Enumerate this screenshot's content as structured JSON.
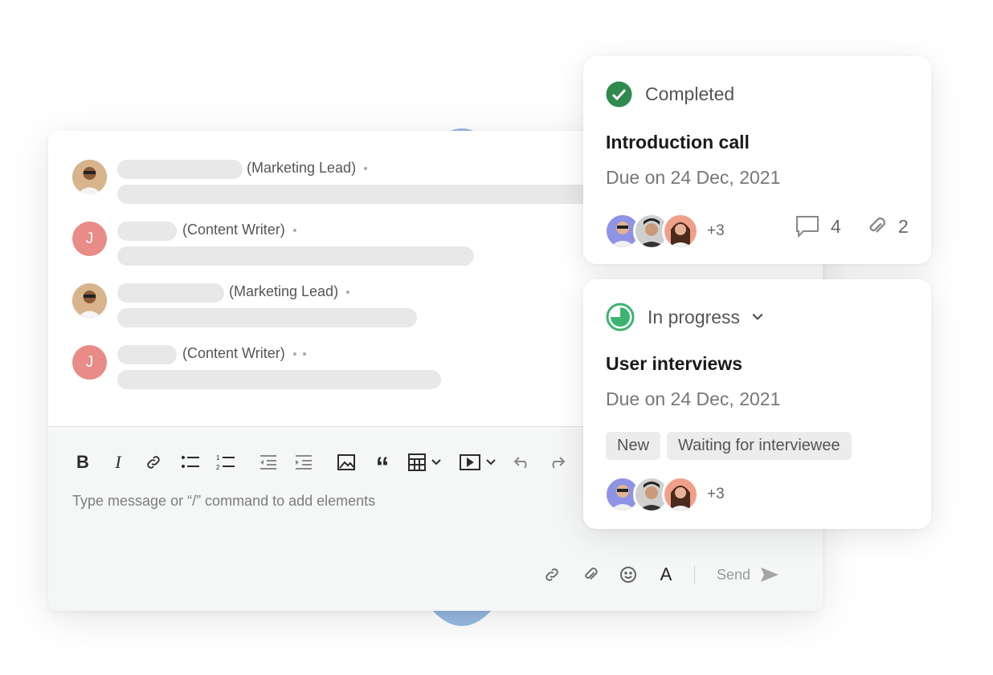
{
  "chat": {
    "messages": [
      {
        "avatar_letter": "",
        "role": "(Marketing Lead)",
        "dots": "•"
      },
      {
        "avatar_letter": "J",
        "role": "(Content Writer)",
        "dots": "•"
      },
      {
        "avatar_letter": "",
        "role": "(Marketing Lead)",
        "dots": "•"
      },
      {
        "avatar_letter": "J",
        "role": "(Content Writer)",
        "dots": "• •"
      }
    ],
    "placeholder": "Type message or “/” command to add elements",
    "toolbar_icons": [
      "bold-icon",
      "italic-icon",
      "link-icon",
      "bullet-list-icon",
      "numbered-list-icon",
      "outdent-icon",
      "indent-icon",
      "image-icon",
      "quote-icon",
      "table-icon",
      "video-icon",
      "undo-icon",
      "redo-icon"
    ],
    "send_label": "Send"
  },
  "tasks": [
    {
      "status": "Completed",
      "title": "Introduction call",
      "due": "Due on 24 Dec, 2021",
      "more_assignees": "+3",
      "comments": "4",
      "attachments": "2"
    },
    {
      "status": "In progress",
      "title": "User interviews",
      "due": "Due on 24 Dec, 2021",
      "tags": [
        "New",
        "Waiting for interviewee"
      ],
      "more_assignees": "+3"
    }
  ],
  "colors": {
    "completed_green": "#2f8a4e",
    "progress_green": "#3cb371",
    "avatar_letter_bg": "#e98b86",
    "blob_blue": "#8fb6de"
  }
}
